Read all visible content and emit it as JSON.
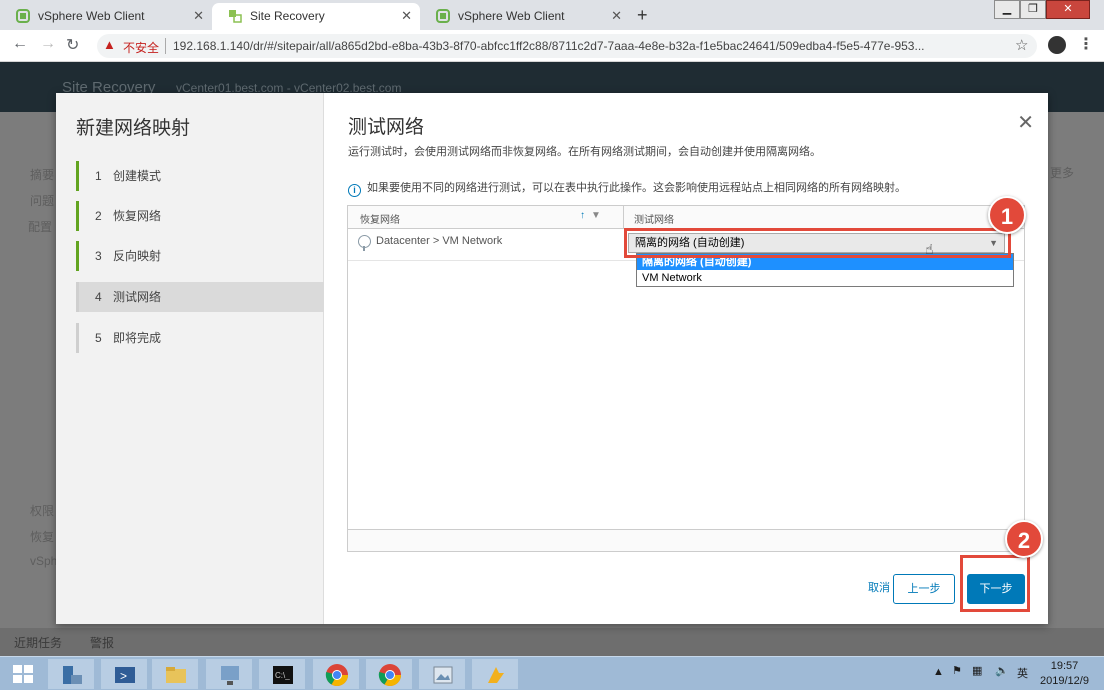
{
  "browser": {
    "tabs": [
      {
        "title": "vSphere Web Client",
        "active": false
      },
      {
        "title": "Site Recovery",
        "active": true
      },
      {
        "title": "vSphere Web Client",
        "active": false
      }
    ],
    "security_label": "不安全",
    "url": "192.168.1.140/dr/#/sitepair/all/a865d2bd-e8ba-43b3-8f70-abfcc1ff2c88/8711c2d7-7aaa-4e8e-b32a-f1e5bac24641/509edba4-f5e5-477e-953..."
  },
  "app": {
    "name": "Site Recovery",
    "subtitle": "vCenter01.best.com - vCenter02.best.com",
    "bg_labels": [
      "摘要",
      "问题",
      "配置",
      "权限",
      "恢复",
      "vSph",
      "更多"
    ],
    "bottom_tabs": [
      "近期任务",
      "警报"
    ]
  },
  "wizard": {
    "title": "新建网络映射",
    "steps": [
      {
        "num": "1",
        "label": "创建模式",
        "state": "done"
      },
      {
        "num": "2",
        "label": "恢复网络",
        "state": "done"
      },
      {
        "num": "3",
        "label": "反向映射",
        "state": "done"
      },
      {
        "num": "4",
        "label": "测试网络",
        "state": "current"
      },
      {
        "num": "5",
        "label": "即将完成",
        "state": "pending"
      }
    ],
    "page_title": "测试网络",
    "description": "运行测试时，会使用测试网络而非恢复网络。在所有网络测试期间，会自动创建并使用隔离网络。",
    "info_text": "如果要使用不同的网络进行测试，可以在表中执行此操作。这会影响使用远程站点上相同网络的所有网络映射。",
    "grid": {
      "col_recovery": "恢复网络",
      "col_test": "测试网络",
      "rows": [
        {
          "recovery_network": "Datacenter > VM Network",
          "test_network": "隔离的网络 (自动创建)"
        }
      ]
    },
    "dropdown_options": [
      {
        "label": "隔离的网络 (自动创建)",
        "selected": true
      },
      {
        "label": "VM Network",
        "selected": false
      }
    ],
    "buttons": {
      "cancel": "取消",
      "back": "上一步",
      "next": "下一步"
    }
  },
  "annotations": {
    "badge1": "1",
    "badge2": "2"
  },
  "taskbar": {
    "ime": "英",
    "time": "19:57",
    "date": "2019/12/9"
  },
  "colors": {
    "accent": "#0079b8",
    "annotation": "#e2493a",
    "step_done": "#62a420"
  }
}
